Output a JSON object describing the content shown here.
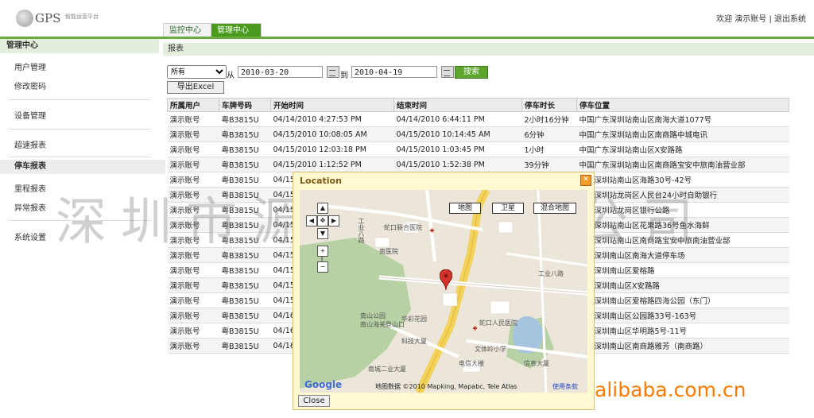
{
  "logo": {
    "text": "GPS",
    "sub": "智能运营平台"
  },
  "userbar": {
    "welcome": "欢迎",
    "user": "演示账号",
    "sep": "|",
    "logout": "退出系统"
  },
  "tabs": [
    {
      "label": "监控中心"
    },
    {
      "label": "管理中心"
    }
  ],
  "sidebar": {
    "title": "管理中心",
    "items": [
      {
        "label": "用户管理"
      },
      {
        "label": "修改密码"
      },
      {
        "label": "设备管理"
      },
      {
        "label": "超速报表"
      },
      {
        "label": "停车报表"
      },
      {
        "label": "里程报表"
      },
      {
        "label": "异常报表"
      },
      {
        "label": "系统设置"
      }
    ]
  },
  "main": {
    "header": "报表",
    "filter": {
      "select_value": "所有",
      "from_label": "从",
      "from_date": "2010-03-20",
      "to_label": "到",
      "to_date": "2010-04-19",
      "search_label": "搜索",
      "export_label": "导出Excel"
    }
  },
  "table": {
    "columns": [
      "所属用户",
      "车牌号码",
      "开始时间",
      "结束时间",
      "停车时长",
      "停车位置"
    ],
    "rows": [
      [
        "演示账号",
        "粤B3815U",
        "04/14/2010 4:27:53 PM",
        "04/14/2010 6:44:11 PM",
        "2小时16分钟",
        "中国广东深圳站南山区南海大道1077号"
      ],
      [
        "演示账号",
        "粤B3815U",
        "04/15/2010 10:08:05 AM",
        "04/15/2010 10:14:45 AM",
        "6分钟",
        "中国广东深圳站南山区南商路中城电讯"
      ],
      [
        "演示账号",
        "粤B3815U",
        "04/15/2010 12:03:18 PM",
        "04/15/2010 1:03:45 PM",
        "1小时",
        "中国广东深圳站南山区X安路路"
      ],
      [
        "演示账号",
        "粤B3815U",
        "04/15/2010 1:12:52 PM",
        "04/15/2010 1:52:38 PM",
        "39分钟",
        "中国广东深圳站南山区南商路宝安中旅南油营业部"
      ],
      [
        "演示账号",
        "粤B3815U",
        "04/15",
        "",
        "",
        "广东深圳站南山区海路30号-42号"
      ],
      [
        "演示账号",
        "粤B3815U",
        "04/15",
        "",
        "",
        "广东深圳站龙岗区人民台24小时自助银行"
      ],
      [
        "演示账号",
        "粤B3815U",
        "04/15",
        "",
        "",
        "广东深圳站龙岗区银行公路"
      ],
      [
        "演示账号",
        "粤B3815U",
        "04/15",
        "",
        "",
        "广东深圳站南山区花果路36号鱼水海鲜"
      ],
      [
        "演示账号",
        "粤B3815U",
        "04/15",
        "",
        "",
        "广东深圳站南山区南商路宝安中旅南油营业部"
      ],
      [
        "演示账号",
        "粤B3815U",
        "04/15",
        "",
        "",
        "广东深圳南山区南海大道停车场"
      ],
      [
        "演示账号",
        "粤B3815U",
        "04/15",
        "",
        "",
        "广东深圳南山区爱榕路"
      ],
      [
        "演示账号",
        "粤B3815U",
        "04/15",
        "",
        "",
        "广东深圳南山区X安路路"
      ],
      [
        "演示账号",
        "粤B3815U",
        "04/15",
        "",
        "",
        "广东深圳南山区爱榕路四海公园（东门）"
      ],
      [
        "演示账号",
        "粤B3815U",
        "04/16",
        "",
        "",
        "广东深圳南山区公园路33号-163号"
      ],
      [
        "演示账号",
        "粤B3815U",
        "04/16",
        "",
        "",
        "广东深圳南山区华明路5号-11号"
      ],
      [
        "演示账号",
        "粤B3815U",
        "04/16",
        "",
        "",
        "广东深圳南山区南商路雅芳（南商路）"
      ]
    ]
  },
  "watermark": "深圳市源科技有限公司",
  "popup": {
    "title": "Location",
    "map_buttons": [
      "地图",
      "卫星",
      "混合地图"
    ],
    "copyright": "地图数据 ©2010 Mapking, Mapabc, Tele Atlas",
    "terms": "使用条款",
    "google": "Google",
    "close_label": "Close",
    "map_labels": [
      "工业八路",
      "蛇口联合医院",
      "南医院",
      "南山公园",
      "南山海关登山口",
      "华彩花园",
      "工业八路",
      "蛇口人民医院",
      "科技大厦",
      "南城二业大厦",
      "文体岭小学",
      "电信大楼",
      "信息大厦"
    ]
  },
  "footer_brand": "alibaba.com.cn"
}
